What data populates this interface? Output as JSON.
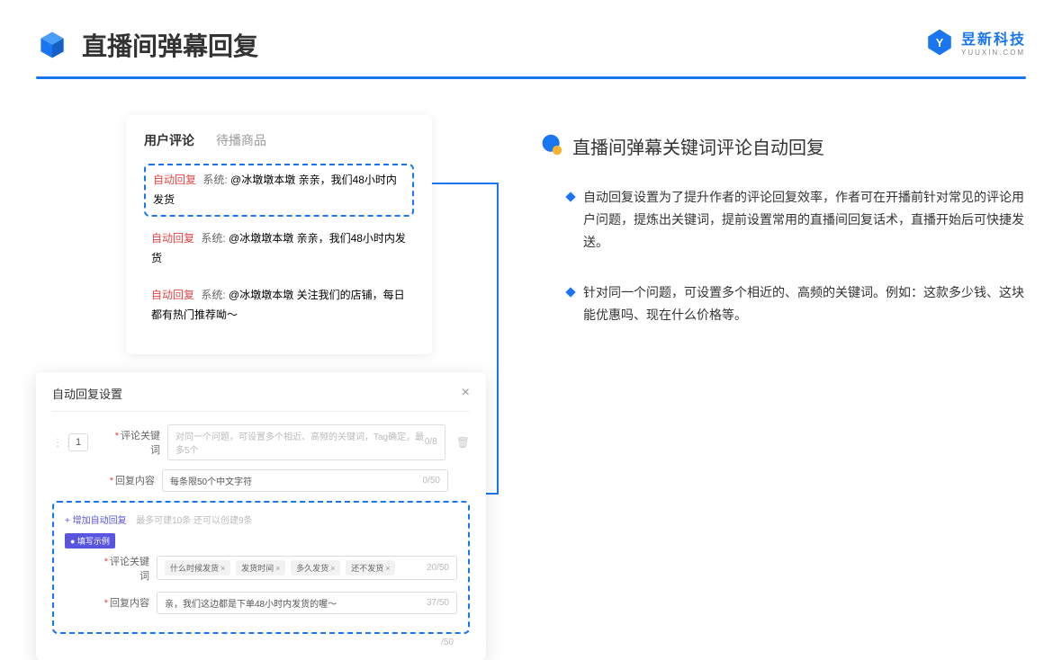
{
  "header": {
    "title": "直播间弹幕回复"
  },
  "brand": {
    "name": "昱新科技",
    "sub": "YUUXIN.COM"
  },
  "commentCard": {
    "tabs": [
      {
        "label": "用户评论",
        "active": true
      },
      {
        "label": "待播商品",
        "active": false
      }
    ],
    "rows": [
      {
        "badge": "自动回复",
        "sys": "系统:",
        "text": "@冰墩墩本墩 亲亲，我们48小时内发货",
        "highlighted": true
      },
      {
        "badge": "自动回复",
        "sys": "系统:",
        "text": "@冰墩墩本墩 亲亲，我们48小时内发货",
        "highlighted": false
      },
      {
        "badge": "自动回复",
        "sys": "系统:",
        "text": "@冰墩墩本墩 关注我们的店铺，每日都有热门推荐呦～",
        "highlighted": false
      }
    ]
  },
  "settings": {
    "title": "自动回复设置",
    "index": "1",
    "keywordLabel": "评论关键词",
    "keywordPlaceholder": "对同一个问题，可设置多个相近、高频的关键词，Tag确定，最多5个",
    "keywordCounter": "0/8",
    "contentLabel": "回复内容",
    "contentPlaceholder": "每条限50个中文字符",
    "contentCounter": "0/50",
    "addLink": "+ 增加自动回复",
    "addHint": "最多可建10条 还可以创建9条",
    "exampleBadge": "● 填写示例",
    "example": {
      "keywordLabel": "评论关键词",
      "tags": [
        "什么时候发货",
        "发货时间",
        "多久发货",
        "还不发货"
      ],
      "keywordCounter": "20/50",
      "contentLabel": "回复内容",
      "contentText": "亲，我们这边都是下单48小时内发货的喔～",
      "contentCounter": "37/50"
    },
    "extraCounter": "/50"
  },
  "right": {
    "heading": "直播间弹幕关键词评论自动回复",
    "bullets": [
      "自动回复设置为了提升作者的评论回复效率，作者可在开播前针对常见的评论用户问题，提炼出关键词，提前设置常用的直播间回复话术，直播开始后可快捷发送。",
      "针对同一个问题，可设置多个相近的、高频的关键词。例如：这款多少钱、这块能优惠吗、现在什么价格等。"
    ]
  }
}
